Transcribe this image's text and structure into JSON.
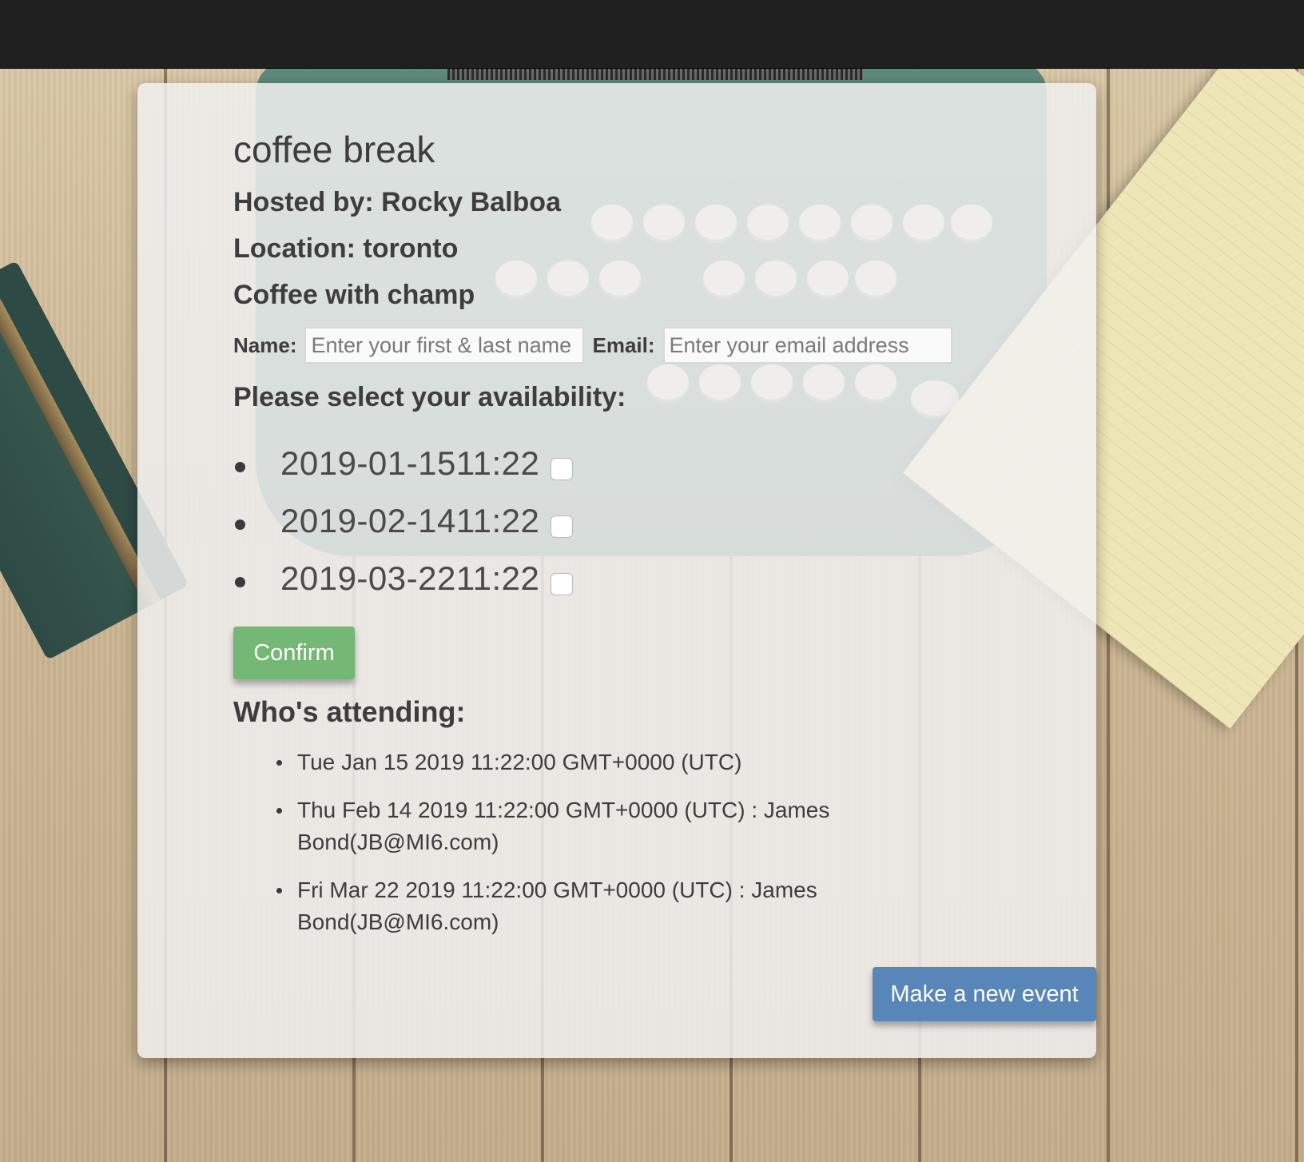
{
  "event": {
    "title": "coffee break",
    "host": "Hosted by: Rocky Balboa",
    "location": "Location: toronto",
    "description": "Coffee with champ"
  },
  "form": {
    "name_label": "Name:",
    "name_placeholder": "Enter your first & last name",
    "name_value": "",
    "email_label": "Email:",
    "email_placeholder": "Enter your email address",
    "email_value": ""
  },
  "availability": {
    "title": "Please select your availability:",
    "slots": [
      {
        "label": "2019-01-1511:22",
        "checked": false
      },
      {
        "label": "2019-02-1411:22",
        "checked": false
      },
      {
        "label": "2019-03-2211:22",
        "checked": false
      }
    ]
  },
  "confirm_label": "Confirm",
  "attending": {
    "title": "Who's attending:",
    "items": [
      "Tue Jan 15 2019 11:22:00 GMT+0000 (UTC)",
      "Thu Feb 14 2019 11:22:00 GMT+0000 (UTC) : James Bond(JB@MI6.com)",
      "Fri Mar 22 2019 11:22:00 GMT+0000 (UTC) : James Bond(JB@MI6.com)"
    ]
  },
  "new_event_label": "Make a new event",
  "colors": {
    "confirm": "#75b774",
    "new_event": "#5886b8",
    "topbar": "#202020"
  }
}
